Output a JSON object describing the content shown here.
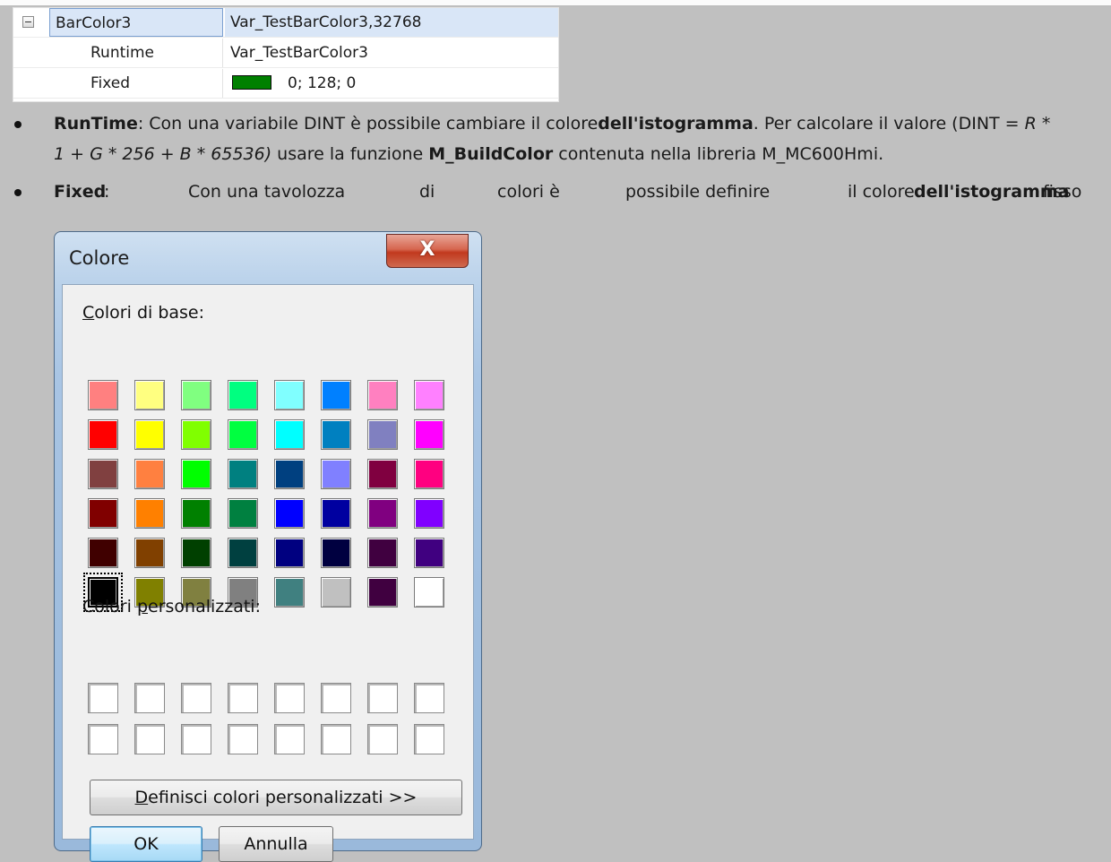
{
  "property_grid": {
    "rows": [
      {
        "name": "BarColor3",
        "value": "Var_TestBarColor3,32768"
      },
      {
        "name": "Runtime",
        "value": "Var_TestBarColor3"
      },
      {
        "name": "Fixed",
        "value": "0; 128; 0",
        "swatch_color": "#008000"
      }
    ]
  },
  "bullets": {
    "runtime": {
      "term": "RunTime",
      "text1": ": Con una variabile DINT è possibile cambiare il colore",
      "bold1": "dell'istogramma",
      "text2": ". Per calcolare il valore (DINT = ",
      "italic1": "R *",
      "italic2": "1 + G * 256 + B * 65536)",
      "text3": " usare la funzione ",
      "func": "M_BuildColor",
      "text4": " contenuta nella libreria M_MC600Hmi."
    },
    "fixed": {
      "term": "Fixed",
      "colon": ":",
      "w1": "Con una tavolozza",
      "w2": "di",
      "w3": "colori è",
      "w4": "possibile definire",
      "w5": "il colore",
      "bold": "dell'istogramma",
      "w6": "fisso"
    }
  },
  "dialog": {
    "title": "Colore",
    "close_label": "X",
    "basic_label_first": "C",
    "basic_label_rest": "olori di base:",
    "custom_label_pre": "Colori ",
    "custom_label_ul": "p",
    "custom_label_rest": "ersonalizzati:",
    "define_ul": "D",
    "define_rest": "efinisci colori personalizzati >>",
    "ok_label": "OK",
    "cancel_label": "Annulla",
    "basic_colors": [
      [
        "#ff8080",
        "#ffff80",
        "#80ff80",
        "#00ff80",
        "#80ffff",
        "#0080ff",
        "#ff80c0",
        "#ff80ff"
      ],
      [
        "#ff0000",
        "#ffff00",
        "#80ff00",
        "#00ff40",
        "#00ffff",
        "#0080c0",
        "#8080c0",
        "#ff00ff"
      ],
      [
        "#804040",
        "#ff8040",
        "#00ff00",
        "#008080",
        "#004080",
        "#8080ff",
        "#800040",
        "#ff0080"
      ],
      [
        "#800000",
        "#ff8000",
        "#008000",
        "#008040",
        "#0000ff",
        "#0000a0",
        "#800080",
        "#8000ff"
      ],
      [
        "#400000",
        "#804000",
        "#004000",
        "#004040",
        "#000080",
        "#000040",
        "#400040",
        "#400080"
      ],
      [
        "#000000",
        "#808000",
        "#808040",
        "#808080",
        "#408080",
        "#c0c0c0",
        "#400040",
        "#ffffff"
      ]
    ],
    "selected_basic": [
      5,
      0
    ]
  }
}
